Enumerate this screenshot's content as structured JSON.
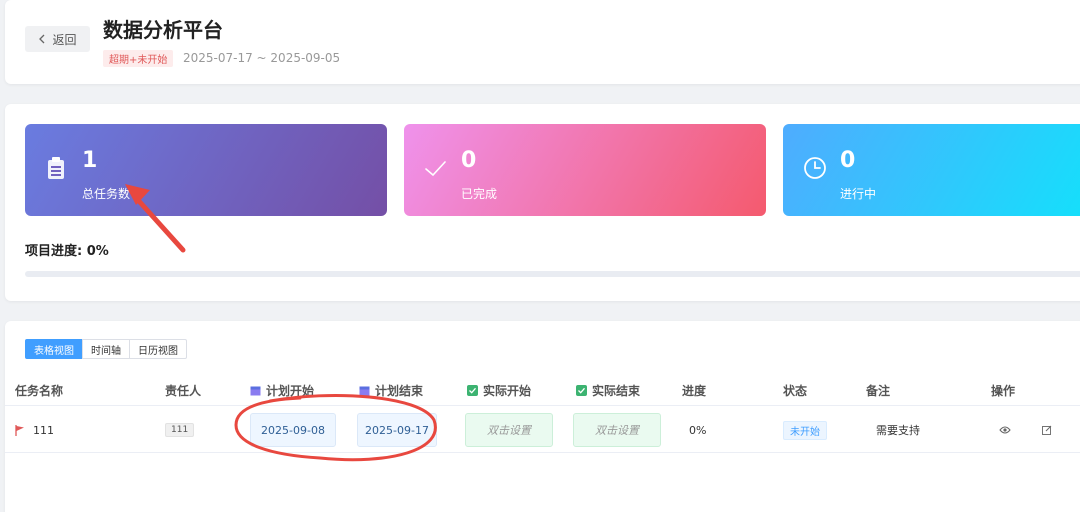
{
  "header": {
    "back_label": "返回",
    "title": "数据分析平台",
    "status_tag": "超期+未开始",
    "date_range": "2025-07-17 ~ 2025-09-05"
  },
  "stats": [
    {
      "value": "1",
      "label": "总任务数",
      "icon": "clipboard-icon"
    },
    {
      "value": "0",
      "label": "已完成",
      "icon": "check-icon"
    },
    {
      "value": "0",
      "label": "进行中",
      "icon": "clock-icon"
    }
  ],
  "progress": {
    "label": "项目进度: 0%",
    "percent": 0
  },
  "views": {
    "tabs": [
      "表格视图",
      "时间轴",
      "日历视图"
    ],
    "active": 0
  },
  "table": {
    "headers": [
      "任务名称",
      "责任人",
      "计划开始",
      "计划结束",
      "实际开始",
      "实际结束",
      "进度",
      "状态",
      "备注",
      "操作"
    ],
    "rows": [
      {
        "name": "111",
        "owner": "111",
        "plan_start": "2025-09-08",
        "plan_end": "2025-09-17",
        "actual_start": "双击设置",
        "actual_end": "双击设置",
        "progress": "0%",
        "state": "未开始",
        "remark": "需要支持"
      }
    ]
  },
  "colors": {
    "accent": "#409eff",
    "overdue": "#e05858",
    "annotation": "#e8483f"
  }
}
